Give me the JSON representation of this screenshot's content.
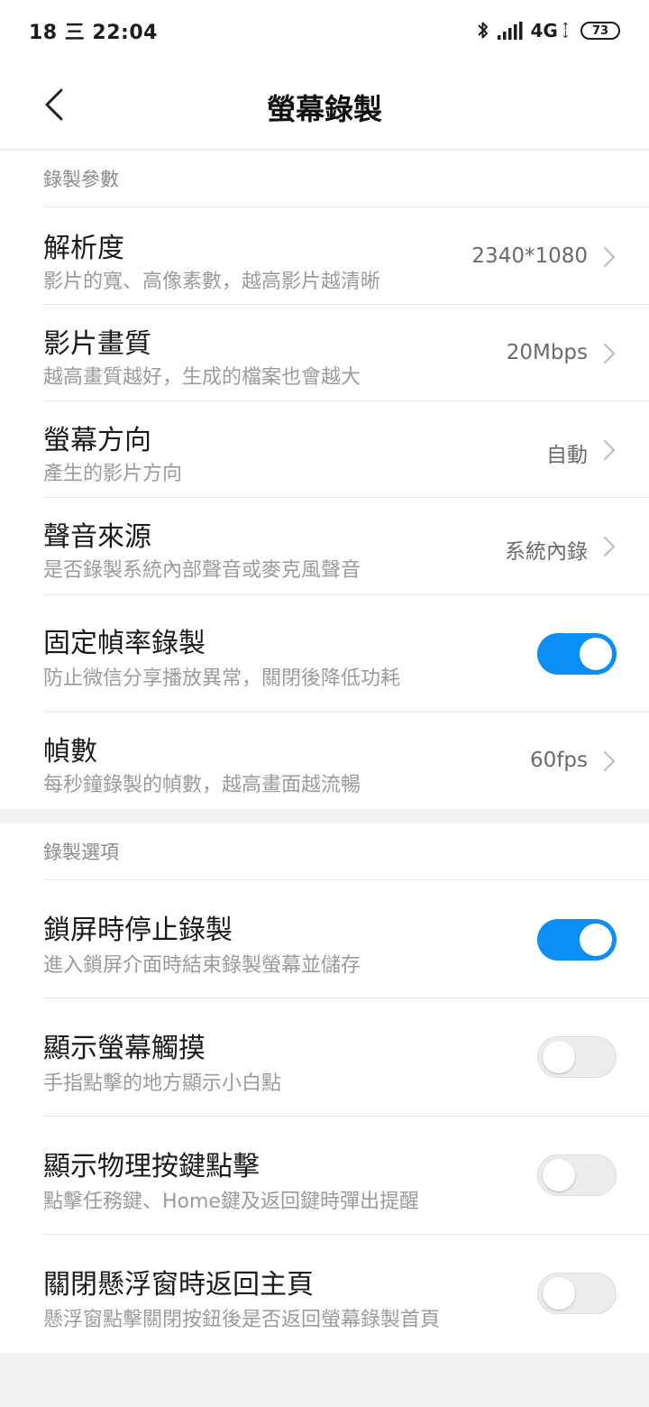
{
  "status_bar": {
    "left_text": "18 三 22:04",
    "network": "4G",
    "battery": "73"
  },
  "header": {
    "title": "螢幕錄製"
  },
  "sections": [
    {
      "header": "錄製參數",
      "rows": [
        {
          "title": "解析度",
          "desc": "影片的寬、高像素數，越高影片越清晰",
          "value": "2340*1080"
        },
        {
          "title": "影片畫質",
          "desc": "越高畫質越好，生成的檔案也會越大",
          "value": "20Mbps"
        },
        {
          "title": "螢幕方向",
          "desc": "產生的影片方向",
          "value": "自動"
        },
        {
          "title": "聲音來源",
          "desc": "是否錄製系統內部聲音或麥克風聲音",
          "value": "系統內錄"
        },
        {
          "title": "固定幀率錄製",
          "desc": "防止微信分享播放異常，關閉後降低功耗",
          "toggle": true
        },
        {
          "title": "幀數",
          "desc": "每秒鐘錄製的幀數，越高畫面越流暢",
          "value": "60fps"
        }
      ]
    },
    {
      "header": "錄製選項",
      "rows": [
        {
          "title": "鎖屏時停止錄製",
          "desc": "進入鎖屏介面時結束錄製螢幕並儲存",
          "toggle": true
        },
        {
          "title": "顯示螢幕觸摸",
          "desc": "手指點擊的地方顯示小白點",
          "toggle": false
        },
        {
          "title": "顯示物理按鍵點擊",
          "desc": "點擊任務鍵、Home鍵及返回鍵時彈出提醒",
          "toggle": false
        },
        {
          "title": "關閉懸浮窗時返回主頁",
          "desc": "懸浮窗點擊關閉按鈕後是否返回螢幕錄製首頁",
          "toggle": false
        }
      ]
    }
  ],
  "colors": {
    "toggle_on": "#0b8ff5",
    "toggle_off": "#ececec"
  }
}
